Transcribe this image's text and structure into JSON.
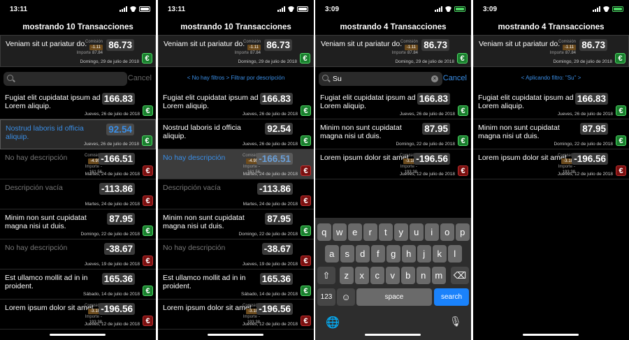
{
  "screens": [
    {
      "time": "13:11",
      "charging": false,
      "title": "mostrando 10 Transacciones",
      "top": {
        "desc": "Veniam sit ut pariatur do.",
        "fee_label": "Comisión",
        "fee_value": "-1.11",
        "imp_label": "Importe",
        "imp_value": "87.84",
        "amount": "86.73",
        "date": "Domingo, 29 de julio de 2018",
        "currency": "€"
      },
      "search": {
        "text": "",
        "cancel": "Cancel"
      },
      "filter": ""
    },
    {
      "time": "13:11",
      "charging": false,
      "title": "mostrando 10 Transacciones",
      "top": {
        "desc": "Veniam sit ut pariatur do.",
        "fee_label": "Comisión",
        "fee_value": "-1.11",
        "imp_label": "Importe",
        "imp_value": "87.84",
        "amount": "86.73",
        "date": "Domingo, 29 de julio de 2018",
        "currency": "€"
      },
      "filter": "< No hay filtros > Filtrar por descripción"
    },
    {
      "time": "3:09",
      "charging": true,
      "title": "mostrando 4 Transacciones",
      "top": {
        "desc": "Veniam sit ut pariatur do.",
        "fee_label": "Comisión",
        "fee_value": "-1.11",
        "imp_label": "Importe",
        "imp_value": "87.84",
        "amount": "86.73",
        "date": "Domingo, 29 de julio de 2018",
        "currency": "€"
      },
      "search": {
        "text": "Su",
        "cancel": "Cancel"
      },
      "filter": ""
    },
    {
      "time": "3:09",
      "charging": true,
      "title": "mostrando 4 Transacciones",
      "top": {
        "desc": "Veniam sit ut pariatur do.",
        "fee_label": "Comisión",
        "fee_value": "-1.11",
        "imp_label": "Importe",
        "imp_value": "87.84",
        "amount": "86.73",
        "date": "Domingo, 29 de julio de 2018",
        "currency": "€"
      },
      "filter": "< Aplicando filtro: \"Su\" >"
    }
  ],
  "rows_full": [
    {
      "desc": "Fugiat elit cupidatat ipsum ad Lorem aliquip.",
      "amount": "166.83",
      "date": "Jueves, 26 de julio de 2018",
      "sign": "pos"
    },
    {
      "desc": "Nostrud laboris id officia aliquip.",
      "amount": "92.54",
      "date": "Jueves, 26 de julio de 2018",
      "sign": "pos"
    },
    {
      "desc": "No hay descripción",
      "amount": "-166.51",
      "date": "Martes, 24 de julio de 2018",
      "sign": "neg",
      "fee_label": "Comisión",
      "fee_value": "-4.95",
      "imp_label": "Importe",
      "imp_value": "-161.56"
    },
    {
      "desc": "Descripción vacía",
      "amount": "-113.86",
      "date": "Martes, 24 de julio de 2018",
      "sign": "neg"
    },
    {
      "desc": "Minim non sunt cupidatat magna nisi ut duis.",
      "amount": "87.95",
      "date": "Domingo, 22 de julio de 2018",
      "sign": "pos"
    },
    {
      "desc": "No hay descripción",
      "amount": "-38.67",
      "date": "Jueves, 19 de julio de 2018",
      "sign": "neg"
    },
    {
      "desc": "Est ullamco mollit ad in in proident.",
      "amount": "165.36",
      "date": "Sábado, 14 de julio de 2018",
      "sign": "pos"
    },
    {
      "desc": "Lorem ipsum dolor sit amet",
      "amount": "-196.56",
      "date": "Jueves, 12 de julio de 2018",
      "sign": "neg",
      "fee_label": "Comisión",
      "fee_value": "-3.18",
      "imp_label": "Importe",
      "imp_value": "-193.38"
    }
  ],
  "rows_filtered": [
    {
      "desc": "Fugiat elit cupidatat ipsum ad Lorem aliquip.",
      "amount": "166.83",
      "date": "Jueves, 26 de julio de 2018",
      "sign": "pos"
    },
    {
      "desc": "Minim non sunt cupidatat magna nisi ut duis.",
      "amount": "87.95",
      "date": "Domingo, 22 de julio de 2018",
      "sign": "pos"
    },
    {
      "desc": "Lorem ipsum dolor sit amet",
      "amount": "-196.56",
      "date": "Jueves, 12 de julio de 2018",
      "sign": "neg",
      "fee_label": "Comisión",
      "fee_value": "-3.18",
      "imp_label": "Importe",
      "imp_value": "-193.38"
    }
  ],
  "keyboard": {
    "row1": [
      "q",
      "w",
      "e",
      "r",
      "t",
      "y",
      "u",
      "i",
      "o",
      "p"
    ],
    "row2": [
      "a",
      "s",
      "d",
      "f",
      "g",
      "h",
      "j",
      "k",
      "l"
    ],
    "row3": [
      "z",
      "x",
      "c",
      "v",
      "b",
      "n",
      "m"
    ],
    "num": "123",
    "space": "space",
    "search": "search"
  },
  "colors": {
    "positive": "#1a7f2e",
    "negative": "#7a1010",
    "accent": "#3a8ee6",
    "fee": "#6b4a1c"
  }
}
